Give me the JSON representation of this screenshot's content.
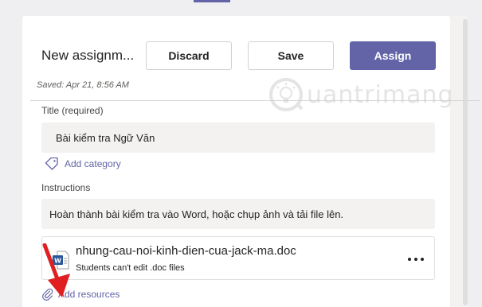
{
  "header": {
    "title": "New assignm...",
    "discard_label": "Discard",
    "save_label": "Save",
    "assign_label": "Assign",
    "saved_status": "Saved: Apr 21, 8:56 AM"
  },
  "form": {
    "title_label": "Title (required)",
    "title_value": "Bài kiểm tra Ngữ Văn",
    "add_category_label": "Add category",
    "instructions_label": "Instructions",
    "instructions_value": "Hoàn thành bài kiểm tra vào Word, hoặc chụp ảnh và tải file lên.",
    "add_resources_label": "Add resources"
  },
  "attachment": {
    "file_name": "nhung-cau-noi-kinh-dien-cua-jack-ma.doc",
    "note": "Students can't edit .doc files",
    "icon": "word-file-icon"
  },
  "watermark": {
    "text": "uantrimang"
  },
  "colors": {
    "accent": "#6264a7",
    "arrow": "#e02020",
    "word_blue": "#2b579a"
  }
}
